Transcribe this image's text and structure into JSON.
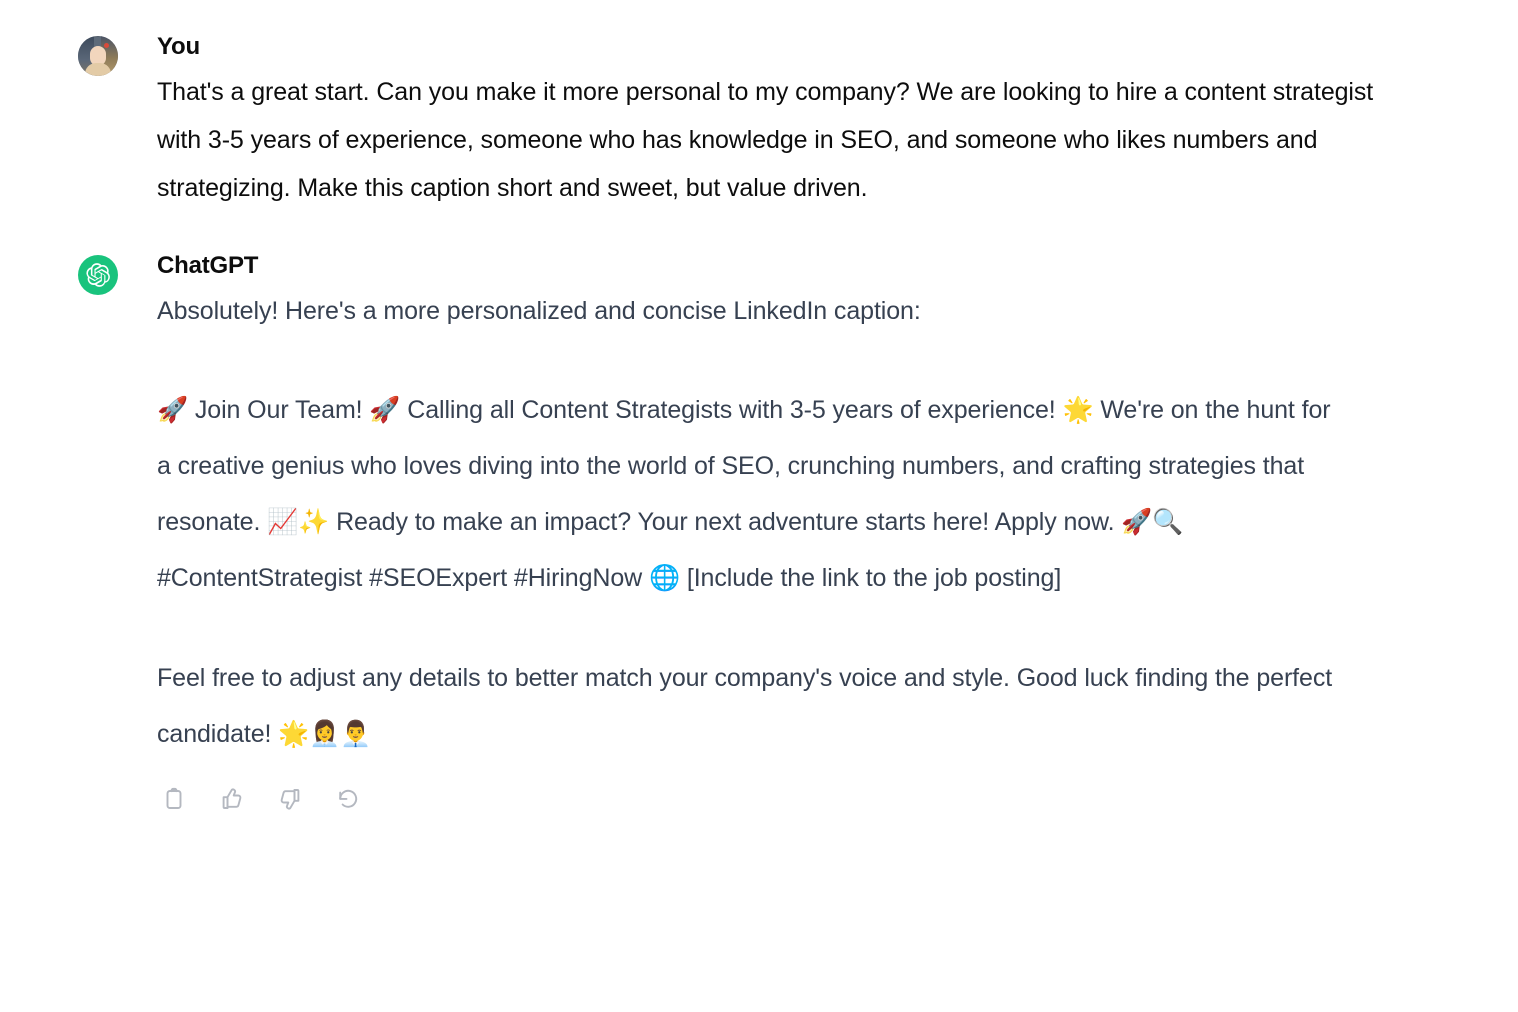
{
  "conversation": {
    "turns": [
      {
        "role_label": "You",
        "avatar": "user-photo-avatar",
        "text": "That's a great start. Can you make it more personal to my company? We are looking to hire a content strategist with 3-5 years of experience, someone who has knowledge in SEO, and someone who likes numbers and strategizing. Make this caption short and sweet, but value driven."
      },
      {
        "role_label": "ChatGPT",
        "avatar": "openai-logo-icon",
        "paragraphs": {
          "intro": "Absolutely! Here's a more personalized and concise LinkedIn caption:",
          "caption": "🚀 Join Our Team! 🚀 Calling all Content Strategists with 3-5 years of experience! 🌟 We're on the hunt for a creative genius who loves diving into the world of SEO, crunching numbers, and crafting strategies that resonate. 📈✨ Ready to make an impact? Your next adventure starts here! Apply now. 🚀🔍 #ContentStrategist #SEOExpert #HiringNow 🌐 [Include the link to the job posting]",
          "closing": "Feel free to adjust any details to better match your company's voice and style. Good luck finding the perfect candidate! 🌟👩‍💼👨‍💼"
        }
      }
    ]
  },
  "message_actions": {
    "copy_label": "Copy",
    "thumbs_up_label": "Good response",
    "thumbs_down_label": "Bad response",
    "regenerate_label": "Regenerate"
  },
  "colors": {
    "user_text": "#0d0d0d",
    "assistant_text": "#374151",
    "chatgpt_avatar_bg": "#19c37d",
    "action_icon": "#b4b8c0",
    "page_background": "#ffffff"
  }
}
